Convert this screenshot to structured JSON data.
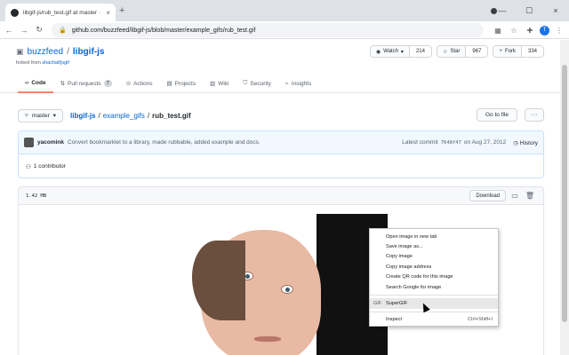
{
  "browser": {
    "tab_title": "libgif-js/rub_test.gif at master · b",
    "tab_close": "×",
    "new_tab": "+",
    "url": "github.com/buzzfeed/libgif-js/blob/master/example_gifs/rub_test.gif",
    "window_min": "—",
    "window_max": "☐",
    "window_close": "×",
    "profile_initial": "T"
  },
  "repo": {
    "owner": "buzzfeed",
    "slash": "/",
    "name": "libgif-js",
    "forked_prefix": "forked from ",
    "forked_from": "shachaf/jsgif",
    "watch_label": "Watch",
    "watch_count": "214",
    "star_label": "Star",
    "star_count": "967",
    "fork_label": "Fork",
    "fork_count": "334"
  },
  "tabs": [
    {
      "label": "Code",
      "active": true
    },
    {
      "label": "Pull requests",
      "count": "7"
    },
    {
      "label": "Actions"
    },
    {
      "label": "Projects"
    },
    {
      "label": "Wiki"
    },
    {
      "label": "Security"
    },
    {
      "label": "Insights"
    }
  ],
  "path": {
    "branch": "master",
    "root": "libgif-js",
    "sep1": "/",
    "dir": "example_gifs",
    "sep2": "/",
    "file": "rub_test.gif",
    "goto_label": "Go to file",
    "more_label": "···"
  },
  "commit": {
    "author": "yacomink",
    "message": "Convert bookmarklet to a library, made rubbable, added example and docs.",
    "latest_label": "Latest commit",
    "sha": "7648f47",
    "date": "on Aug 27, 2012",
    "history_label": "History",
    "contributors": "1 contributor"
  },
  "file": {
    "size": "1.42 MB",
    "download_label": "Download"
  },
  "context_menu": {
    "items": [
      "Open image in new tab",
      "Save image as...",
      "Copy image",
      "Copy image address",
      "Create QR code for this image",
      "Search Google for image"
    ],
    "extension_icon": "GIF",
    "extension_item": "SuperGIF",
    "inspect_label": "Inspect",
    "inspect_shortcut": "Ctrl+Shift+I"
  },
  "colors": {
    "link": "#0366d6",
    "active_tab_underline": "#f9826c",
    "commit_bg": "#f1f8ff"
  }
}
